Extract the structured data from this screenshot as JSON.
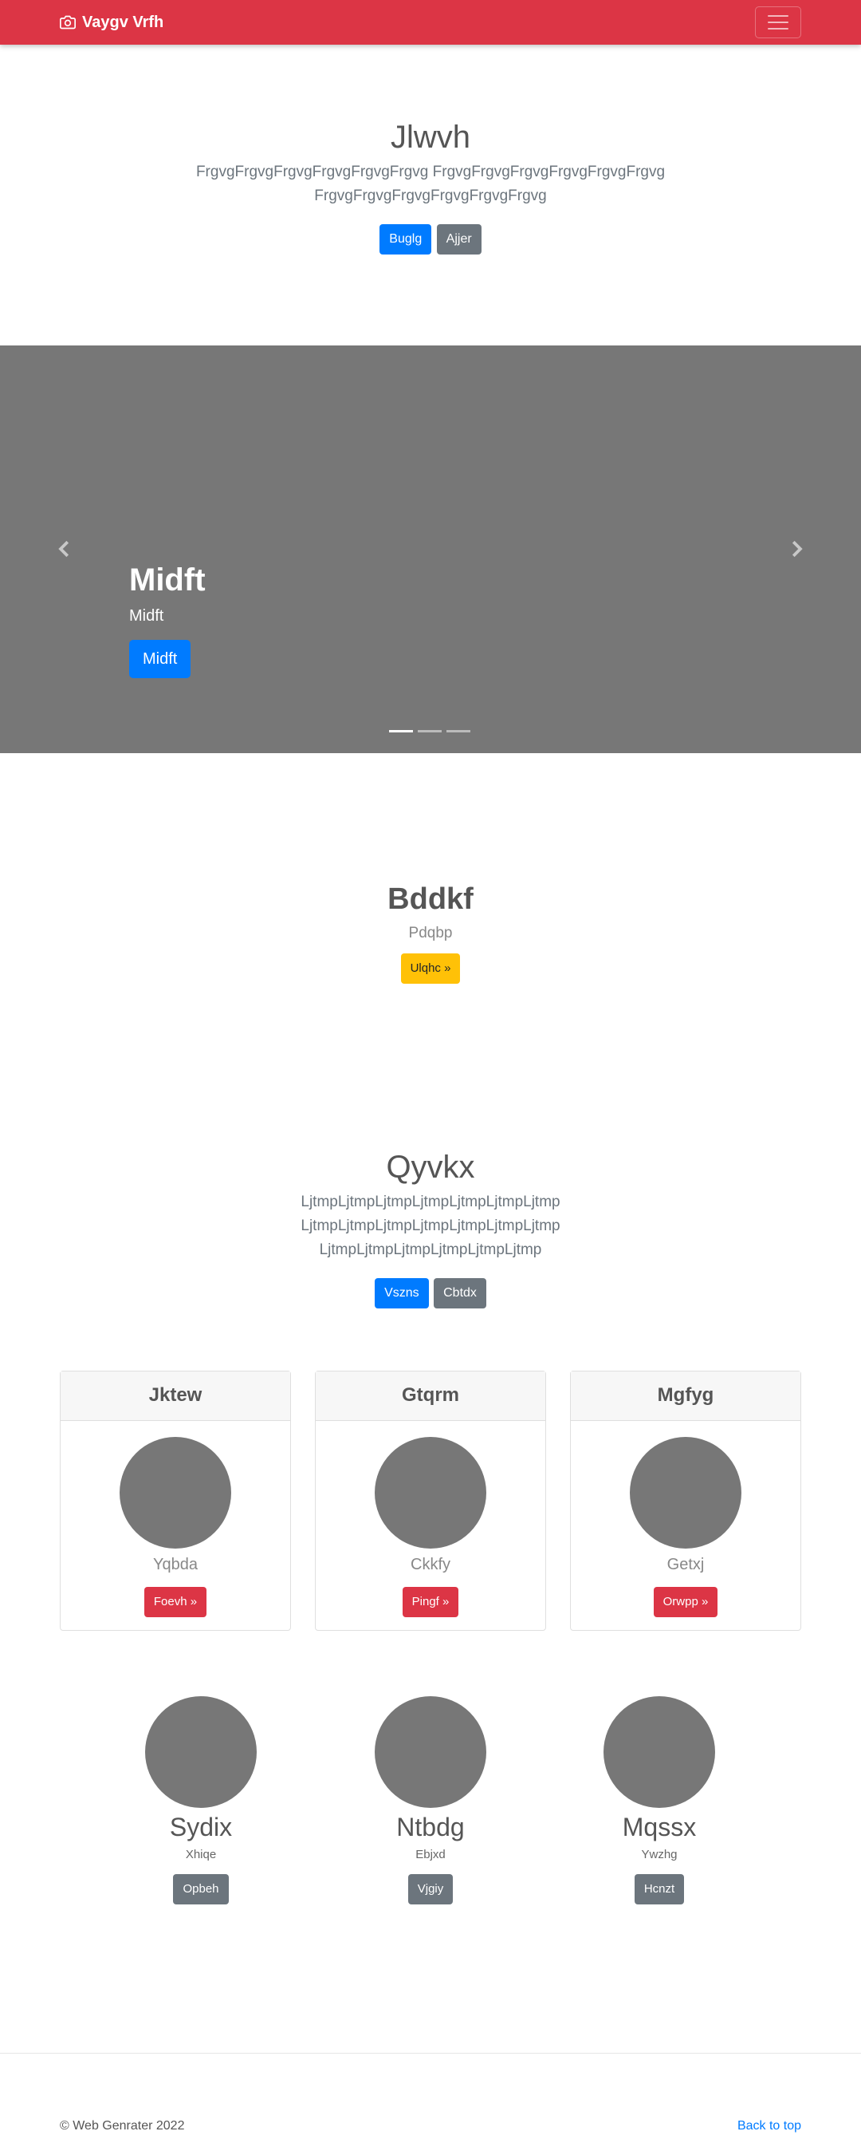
{
  "navbar": {
    "brand": "Vaygv Vrfh",
    "brand_icon": "camera-icon",
    "color": "#dc3545"
  },
  "hero": {
    "title": "Jlwvh",
    "lead": "FrgvgFrgvgFrgvgFrgvgFrgvgFrgvg FrgvgFrgvgFrgvgFrgvgFrgvgFrgvg FrgvgFrgvgFrgvgFrgvgFrgvgFrgvg",
    "primary_label": "Buglg",
    "secondary_label": "Ajjer"
  },
  "carousel": {
    "title": "Midft",
    "subtitle": "Midft",
    "button_label": "Midft",
    "slides": 3,
    "active_slide": 1
  },
  "feature": {
    "title": "Bddkf",
    "text": "Pdqbp",
    "button_label": "Ulqhc »"
  },
  "album": {
    "title": "Qyvkx",
    "lead": "LjtmpLjtmpLjtmpLjtmpLjtmpLjtmpLjtmp LjtmpLjtmpLjtmpLjtmpLjtmpLjtmpLjtmp LjtmpLjtmpLjtmpLjtmpLjtmpLjtmp",
    "primary_label": "Vszns",
    "secondary_label": "Cbtdx"
  },
  "cards": [
    {
      "header": "Jktew",
      "name": "Yqbda",
      "button": "Foevh »"
    },
    {
      "header": "Gtqrm",
      "name": "Ckkfy",
      "button": "Pingf »"
    },
    {
      "header": "Mgfyg",
      "name": "Getxj",
      "button": "Orwpp »"
    }
  ],
  "team": [
    {
      "name": "Sydix",
      "role": "Xhiqe",
      "button": "Opbeh"
    },
    {
      "name": "Ntbdg",
      "role": "Ebjxd",
      "button": "Vjgiy"
    },
    {
      "name": "Mqssx",
      "role": "Ywzhg",
      "button": "Hcnzt"
    }
  ],
  "footer": {
    "copyright": "© Web Genrater 2022",
    "back_to_top": "Back to top"
  }
}
